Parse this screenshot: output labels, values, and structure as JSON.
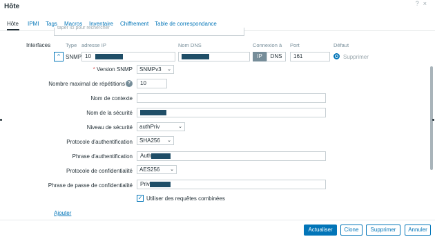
{
  "dialog": {
    "title": "Hôte"
  },
  "tabs": [
    {
      "label": "Hôte",
      "active": true
    },
    {
      "label": "IPMI"
    },
    {
      "label": "Tags"
    },
    {
      "label": "Macros"
    },
    {
      "label": "Inventaire"
    },
    {
      "label": "Chiffrement"
    },
    {
      "label": "Table de correspondance"
    }
  ],
  "search": {
    "placeholder": "taper ici pour rechercher"
  },
  "interfaces": {
    "label": "Interfaces",
    "columns": {
      "type": "Type",
      "ip": "adresse IP",
      "dns": "Nom DNS",
      "connect": "Connexion à",
      "port": "Port",
      "default": "Défaut"
    },
    "row": {
      "type": "SNMP",
      "ip_value": "10",
      "connect_ip": "IP",
      "connect_dns": "DNS",
      "port": "161",
      "remove": "Supprimer"
    }
  },
  "snmp": {
    "version_label": "Version SNMP",
    "version_value": "SNMPv3",
    "max_repetitions_label": "Nombre maximal de répétitions",
    "max_repetitions_value": "10",
    "context_label": "Nom de contexte",
    "context_value": "",
    "security_name_label": "Nom de la sécurité",
    "security_level_label": "Niveau de sécurité",
    "security_level_value": "authPriv",
    "auth_protocol_label": "Protocole d'authentification",
    "auth_protocol_value": "SHA256",
    "auth_phrase_label": "Phrase d'authentification",
    "auth_phrase_value": "Auth",
    "priv_protocol_label": "Protocole de confidentialité",
    "priv_protocol_value": "AES256",
    "priv_phrase_label": "Phrase de passe de confidentialité",
    "priv_phrase_value": "Priv",
    "bulk_label": "Utiliser des requêtes combinées",
    "bulk_checked": true
  },
  "add_link": "Ajouter",
  "footer": {
    "update": "Actualiser",
    "clone": "Clone",
    "delete": "Supprimer",
    "cancel": "Annuler"
  },
  "colors": {
    "accent": "#0275b8",
    "muted": "#768d99",
    "redaction": "#1f4e67"
  }
}
